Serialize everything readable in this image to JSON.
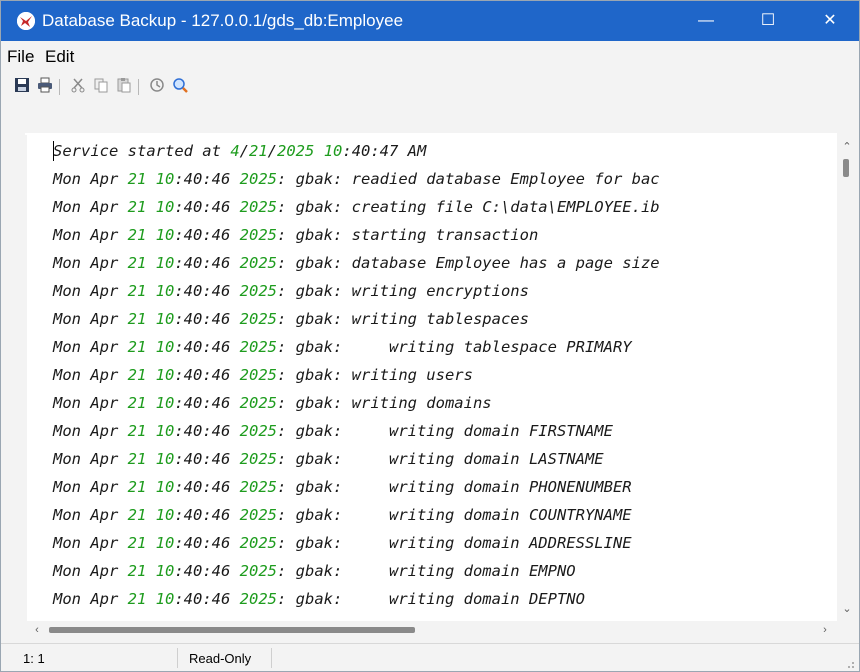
{
  "window": {
    "title": "Database Backup - 127.0.0.1/gds_db:Employee",
    "minimize_glyph": "—",
    "maximize_glyph": "☐",
    "close_glyph": "✕"
  },
  "menu": {
    "file": "File",
    "edit": "Edit"
  },
  "toolbar": {
    "icons": [
      "save-icon",
      "print-icon",
      "cut-icon",
      "copy-icon",
      "paste-icon",
      "history-icon",
      "find-icon"
    ]
  },
  "colors": {
    "titlebar": "#1f66c9",
    "number_highlight": "#1e9c1e",
    "app_icon": "#c62828"
  },
  "log": {
    "first_line": [
      "Service started at ",
      "4",
      "/",
      "21",
      "/",
      "2025",
      " ",
      "10",
      ":40:47 AM"
    ],
    "prefix": [
      "Mon Apr ",
      "21",
      " ",
      "10",
      ":40:46 ",
      "2025",
      ": gbak: "
    ],
    "messages": [
      "readied database Employee for bac",
      "creating file C:\\data\\EMPLOYEE.ib",
      "starting transaction",
      "database Employee has a page size",
      "writing encryptions",
      "writing tablespaces",
      "    writing tablespace PRIMARY",
      "writing users",
      "writing domains",
      "    writing domain FIRSTNAME",
      "    writing domain LASTNAME",
      "    writing domain PHONENUMBER",
      "    writing domain COUNTRYNAME",
      "    writing domain ADDRESSLINE",
      "    writing domain EMPNO",
      "    writing domain DEPTNO"
    ]
  },
  "status": {
    "position": "1: 1",
    "mode": "Read-Only"
  }
}
